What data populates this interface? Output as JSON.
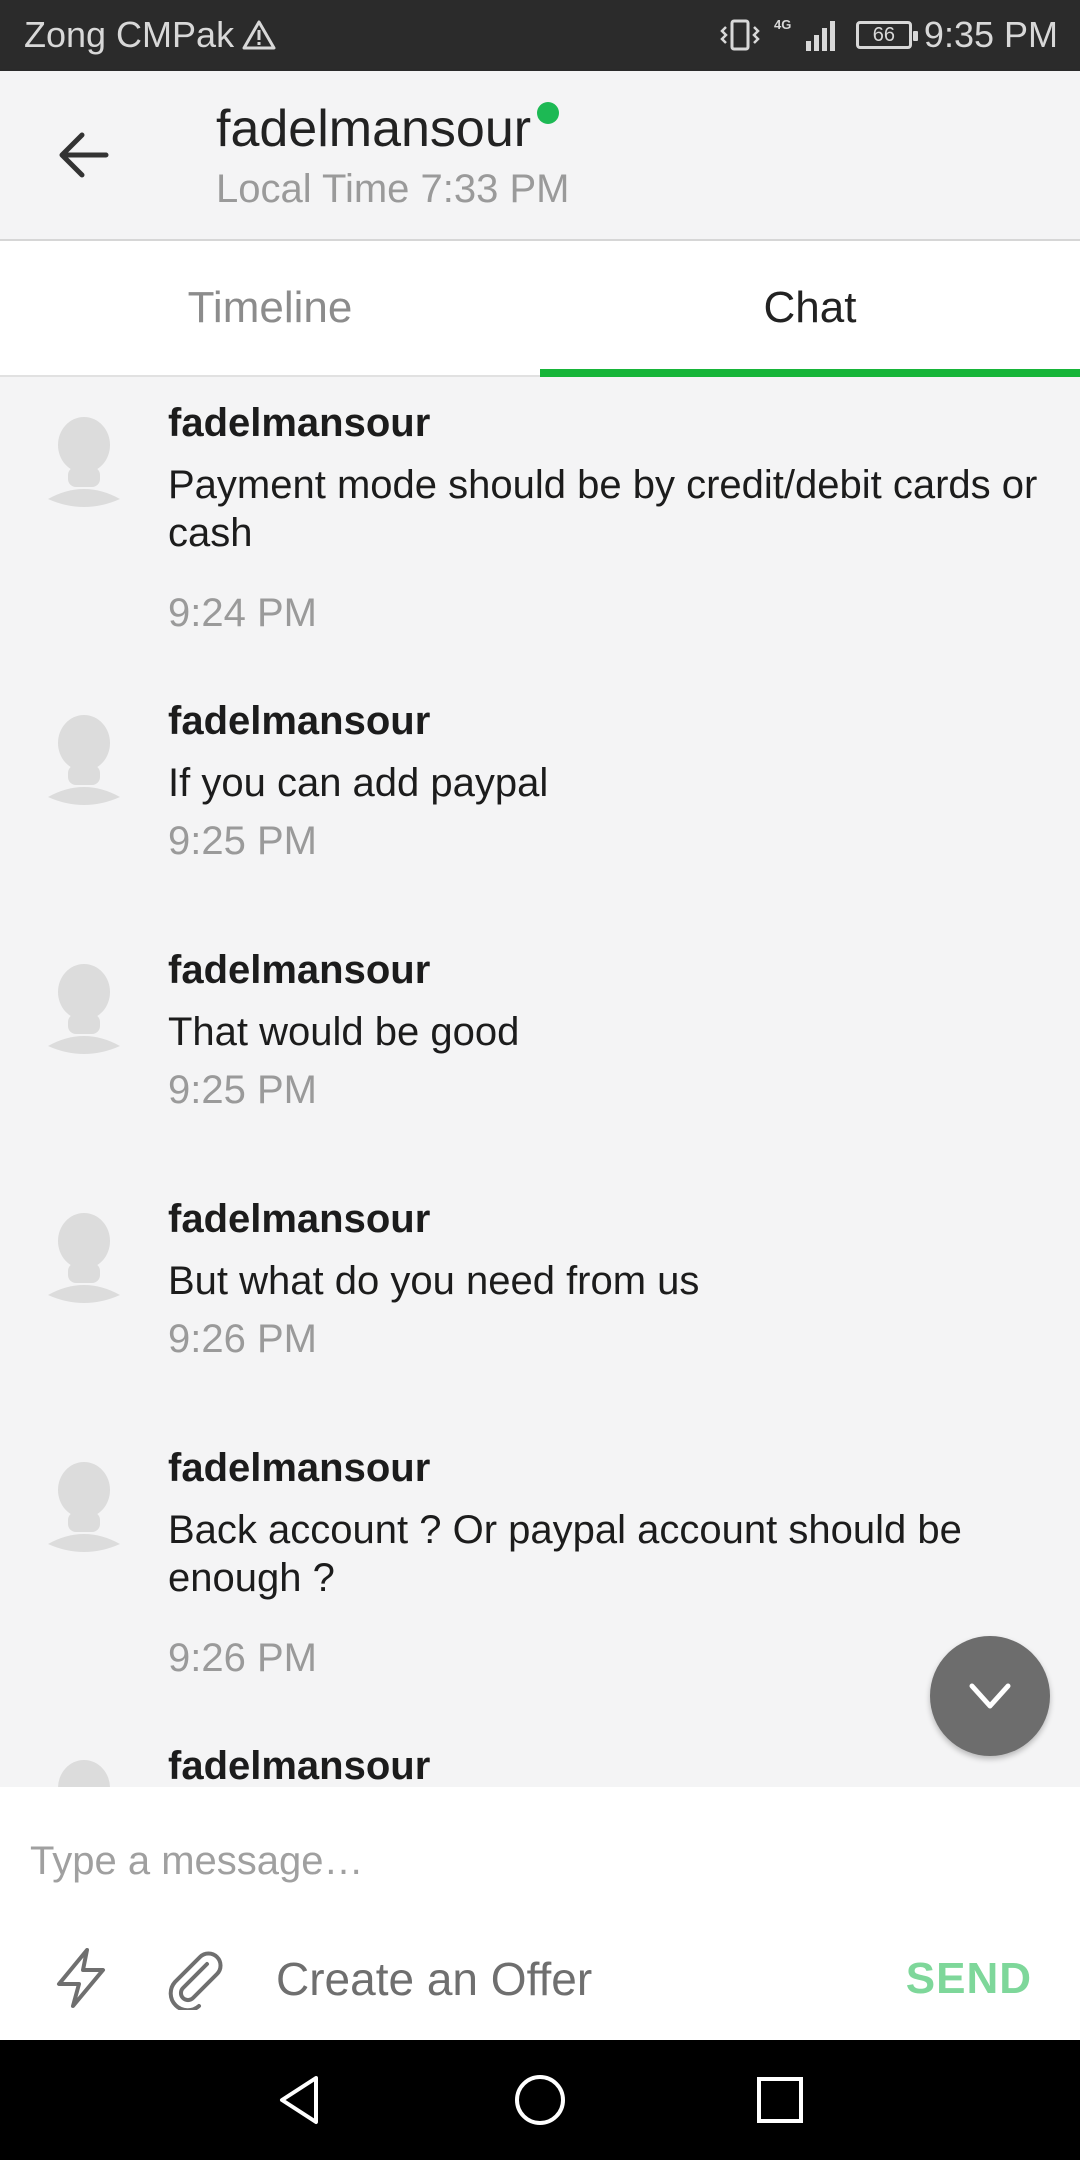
{
  "status_bar": {
    "carrier": "Zong CMPak",
    "warning_icon": "warning-icon",
    "battery": "66",
    "time": "9:35 PM",
    "network": "4G"
  },
  "header": {
    "back_icon": "arrow-left-icon",
    "title": "fadelmansour",
    "online_color": "#1db954",
    "subtitle": "Local Time 7:33 PM"
  },
  "tabs": [
    {
      "label": "Timeline",
      "active": false
    },
    {
      "label": "Chat",
      "active": true
    }
  ],
  "accent_color": "#17b539",
  "messages": [
    {
      "sender": "fadelmansour",
      "text": "Payment mode should be by credit/debit cards or cash",
      "time": "9:24 PM"
    },
    {
      "sender": "fadelmansour",
      "text": "If you can add paypal",
      "time": "9:25 PM"
    },
    {
      "sender": "fadelmansour",
      "text": "That would be good",
      "time": "9:25 PM"
    },
    {
      "sender": "fadelmansour",
      "text": "But what do you need from us",
      "time": "9:26 PM"
    },
    {
      "sender": "fadelmansour",
      "text": "Back account ? Or paypal account should be enough ?",
      "time": "9:26 PM"
    },
    {
      "sender": "fadelmansour",
      "text": "",
      "time": ""
    }
  ],
  "composer": {
    "placeholder": "Type a message…",
    "value": "",
    "offer_label": "Create an Offer",
    "send_label": "SEND",
    "send_color": "#7ed79a"
  }
}
